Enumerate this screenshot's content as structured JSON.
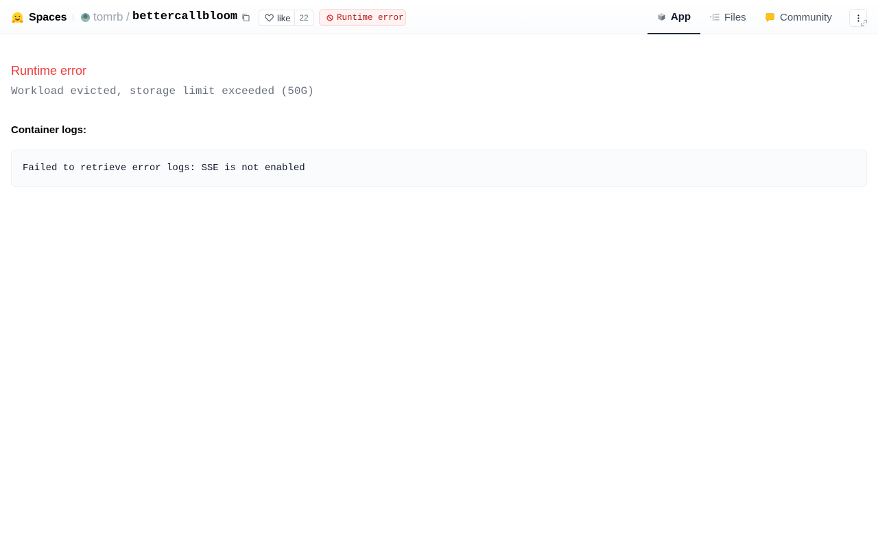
{
  "header": {
    "brand_label": "Spaces",
    "brand_icon": "hugging-face-emoji-icon",
    "owner": "tomrb",
    "separator": "/",
    "repo_name": "bettercallbloom",
    "like_label": "like",
    "like_count": "22",
    "status_label": "Runtime error",
    "status_color": "#b91c1c"
  },
  "tabs": [
    {
      "label": "App",
      "icon": "cube-icon",
      "active": true
    },
    {
      "label": "Files",
      "icon": "file-tree-icon",
      "active": false
    },
    {
      "label": "Community",
      "icon": "chat-bubble-icon",
      "active": false
    }
  ],
  "main": {
    "error_title": "Runtime error",
    "error_message": "Workload evicted, storage limit exceeded (50G)",
    "logs_heading": "Container logs:",
    "logs_text": "Failed to retrieve error logs: SSE is not enabled"
  },
  "colors": {
    "error_red": "#ef3b3b",
    "active_tab_underline": "#1f2937"
  }
}
